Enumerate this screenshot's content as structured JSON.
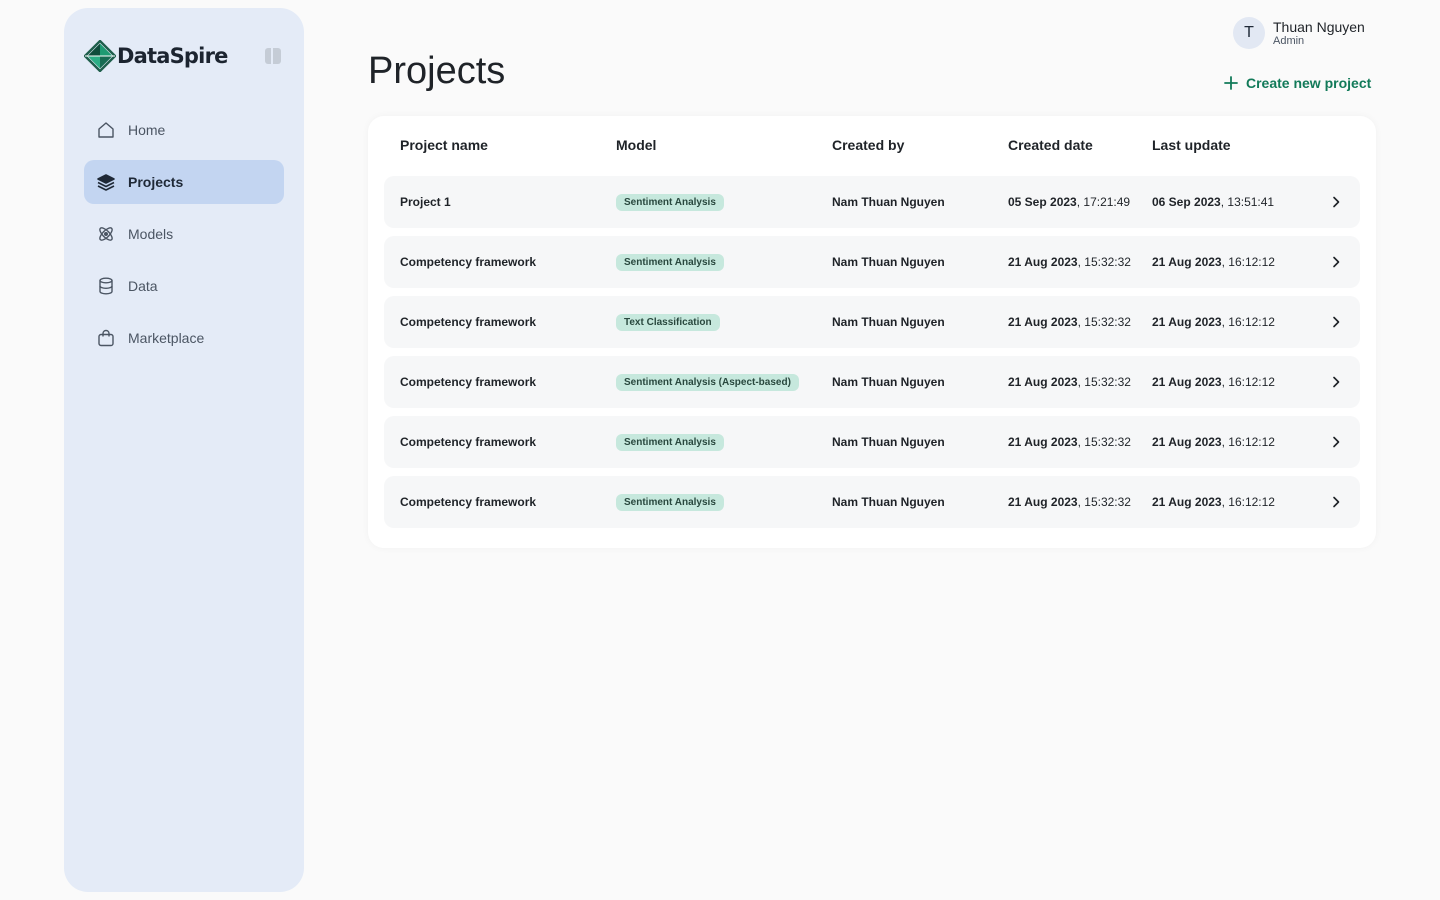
{
  "brand": {
    "name": "DataSpire"
  },
  "sidebar": {
    "items": [
      {
        "label": "Home",
        "icon": "home-icon",
        "active": false
      },
      {
        "label": "Projects",
        "icon": "layers-icon",
        "active": true
      },
      {
        "label": "Models",
        "icon": "atom-icon",
        "active": false
      },
      {
        "label": "Data",
        "icon": "database-icon",
        "active": false
      },
      {
        "label": "Marketplace",
        "icon": "shopping-bag-icon",
        "active": false
      }
    ]
  },
  "header": {
    "title": "Projects",
    "create_label": "Create new project"
  },
  "user": {
    "initial": "T",
    "name": "Thuan Nguyen",
    "role": "Admin"
  },
  "table": {
    "columns": [
      "Project name",
      "Model",
      "Created by",
      "Created date",
      "Last update"
    ],
    "rows": [
      {
        "name": "Project 1",
        "model": "Sentiment Analysis",
        "created_by": "Nam Thuan Nguyen",
        "created_date": "05 Sep 2023",
        "created_time": "17:21:49",
        "updated_date": "06 Sep 2023",
        "updated_time": "13:51:41"
      },
      {
        "name": "Competency framework",
        "model": "Sentiment Analysis",
        "created_by": "Nam Thuan Nguyen",
        "created_date": "21 Aug 2023",
        "created_time": "15:32:32",
        "updated_date": "21 Aug 2023",
        "updated_time": "16:12:12"
      },
      {
        "name": "Competency framework",
        "model": "Text Classification",
        "created_by": "Nam Thuan Nguyen",
        "created_date": "21 Aug 2023",
        "created_time": "15:32:32",
        "updated_date": "21 Aug 2023",
        "updated_time": "16:12:12"
      },
      {
        "name": "Competency framework",
        "model": "Sentiment Analysis (Aspect-based)",
        "created_by": "Nam Thuan Nguyen",
        "created_date": "21 Aug 2023",
        "created_time": "15:32:32",
        "updated_date": "21 Aug 2023",
        "updated_time": "16:12:12"
      },
      {
        "name": "Competency framework",
        "model": "Sentiment Analysis",
        "created_by": "Nam Thuan Nguyen",
        "created_date": "21 Aug 2023",
        "created_time": "15:32:32",
        "updated_date": "21 Aug 2023",
        "updated_time": "16:12:12"
      },
      {
        "name": "Competency framework",
        "model": "Sentiment Analysis",
        "created_by": "Nam Thuan Nguyen",
        "created_date": "21 Aug 2023",
        "created_time": "15:32:32",
        "updated_date": "21 Aug 2023",
        "updated_time": "16:12:12"
      }
    ]
  },
  "colors": {
    "accent": "#127a59",
    "sidebar_bg": "#e4ebf7",
    "nav_active_bg": "#c3d5f1",
    "badge_bg": "#c6e8dd",
    "row_bg": "#f6f7f8"
  }
}
